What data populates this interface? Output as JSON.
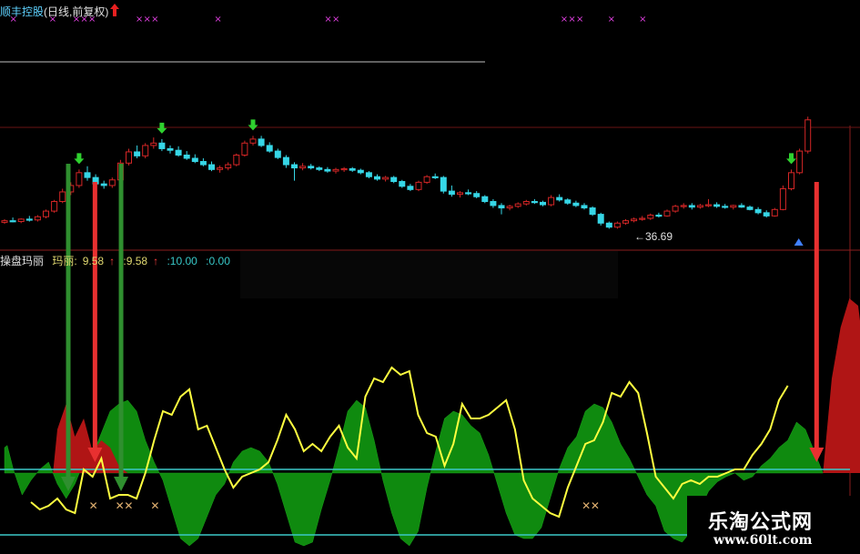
{
  "main_panel": {
    "name": "顺丰控股",
    "period": "(日线,前复权)"
  },
  "indicator_panel": {
    "name": "操盘玛丽",
    "label": "玛丽:",
    "value1": "9.58",
    "value2": ":9.58",
    "value3": ":10.00",
    "value4": ":0.00"
  },
  "annotations": {
    "low_price": "36.69"
  },
  "watermark": {
    "site_name": "乐淘公式网",
    "url": "www.60lt.com"
  },
  "colors": {
    "up": "#d42626",
    "down": "#36d6e6",
    "buy_signal": "#2fd12f",
    "sell_signal": "#e83030",
    "yellow_line": "#ffff40",
    "green_fill": "#0f8a0f",
    "red_fill": "#b01515",
    "cyan_line": "#3cc8c8"
  },
  "chart_data": [
    {
      "type": "candlestick",
      "low_label": 36.69,
      "ohlc": [
        [
          39.0,
          39.4,
          38.8,
          39.2
        ],
        [
          39.2,
          39.6,
          39.0,
          39.1
        ],
        [
          39.1,
          39.5,
          38.9,
          39.4
        ],
        [
          39.4,
          39.8,
          39.1,
          39.3
        ],
        [
          39.3,
          39.9,
          39.1,
          39.7
        ],
        [
          39.7,
          40.6,
          39.5,
          40.4
        ],
        [
          40.4,
          41.8,
          40.2,
          41.6
        ],
        [
          41.6,
          43.2,
          41.4,
          42.8
        ],
        [
          42.8,
          44.0,
          42.4,
          43.6
        ],
        [
          43.6,
          45.6,
          43.3,
          45.2
        ],
        [
          45.2,
          46.0,
          44.2,
          44.6
        ],
        [
          44.6,
          45.0,
          43.5,
          43.8
        ],
        [
          43.8,
          44.2,
          43.2,
          43.6
        ],
        [
          43.6,
          44.6,
          43.3,
          44.3
        ],
        [
          44.3,
          46.8,
          44.1,
          46.4
        ],
        [
          46.4,
          48.2,
          46.1,
          47.8
        ],
        [
          47.8,
          48.6,
          47.0,
          47.3
        ],
        [
          47.3,
          48.9,
          47.0,
          48.6
        ],
        [
          48.6,
          49.6,
          48.2,
          48.9
        ],
        [
          48.9,
          49.4,
          47.9,
          48.2
        ],
        [
          48.2,
          48.6,
          47.6,
          48.0
        ],
        [
          48.0,
          48.5,
          47.2,
          47.4
        ],
        [
          47.4,
          47.9,
          46.8,
          47.0
        ],
        [
          47.0,
          47.5,
          46.4,
          46.6
        ],
        [
          46.6,
          47.0,
          46.0,
          46.2
        ],
        [
          46.2,
          46.6,
          45.4,
          45.6
        ],
        [
          45.6,
          46.1,
          45.2,
          45.8
        ],
        [
          45.8,
          46.5,
          45.5,
          46.2
        ],
        [
          46.2,
          47.6,
          46.0,
          47.4
        ],
        [
          47.4,
          49.2,
          47.2,
          48.9
        ],
        [
          48.9,
          49.8,
          48.6,
          49.4
        ],
        [
          49.4,
          49.8,
          48.4,
          48.6
        ],
        [
          48.6,
          49.0,
          47.7,
          47.9
        ],
        [
          47.9,
          48.2,
          46.9,
          47.1
        ],
        [
          47.1,
          47.4,
          45.8,
          46.2
        ],
        [
          46.2,
          46.5,
          44.2,
          45.8
        ],
        [
          45.8,
          46.4,
          45.5,
          46.0
        ],
        [
          46.0,
          46.3,
          45.6,
          45.8
        ],
        [
          45.8,
          46.0,
          45.4,
          45.6
        ],
        [
          45.6,
          45.9,
          45.2,
          45.4
        ],
        [
          45.4,
          45.8,
          45.1,
          45.6
        ],
        [
          45.6,
          45.9,
          45.3,
          45.7
        ],
        [
          45.7,
          45.9,
          45.3,
          45.5
        ],
        [
          45.5,
          45.7,
          45.0,
          45.2
        ],
        [
          45.2,
          45.4,
          44.5,
          44.7
        ],
        [
          44.7,
          45.0,
          44.2,
          44.4
        ],
        [
          44.4,
          44.8,
          44.1,
          44.6
        ],
        [
          44.6,
          44.8,
          43.9,
          44.1
        ],
        [
          44.1,
          44.3,
          43.3,
          43.5
        ],
        [
          43.5,
          43.8,
          42.9,
          43.1
        ],
        [
          43.1,
          44.2,
          42.9,
          44.0
        ],
        [
          44.0,
          44.9,
          43.8,
          44.7
        ],
        [
          44.7,
          45.1,
          44.4,
          44.6
        ],
        [
          44.6,
          44.8,
          42.6,
          42.9
        ],
        [
          42.9,
          43.6,
          42.2,
          42.5
        ],
        [
          42.5,
          42.9,
          42.1,
          42.7
        ],
        [
          42.7,
          43.1,
          42.4,
          42.6
        ],
        [
          42.6,
          42.9,
          42.0,
          42.2
        ],
        [
          42.2,
          42.4,
          41.4,
          41.6
        ],
        [
          41.6,
          41.9,
          40.8,
          41.1
        ],
        [
          41.1,
          41.4,
          40.0,
          40.8
        ],
        [
          40.8,
          41.2,
          40.5,
          41.0
        ],
        [
          41.0,
          41.5,
          40.8,
          41.3
        ],
        [
          41.3,
          41.8,
          41.1,
          41.6
        ],
        [
          41.6,
          41.9,
          41.3,
          41.5
        ],
        [
          41.5,
          41.7,
          41.0,
          41.2
        ],
        [
          41.2,
          42.4,
          41.0,
          42.1
        ],
        [
          42.1,
          42.5,
          41.6,
          41.8
        ],
        [
          41.8,
          42.0,
          41.2,
          41.4
        ],
        [
          41.4,
          41.7,
          40.9,
          41.1
        ],
        [
          41.1,
          41.4,
          40.6,
          40.8
        ],
        [
          40.8,
          41.0,
          39.8,
          40.0
        ],
        [
          40.0,
          40.2,
          38.6,
          38.9
        ],
        [
          38.9,
          39.1,
          38.2,
          38.4
        ],
        [
          38.4,
          39.1,
          38.2,
          38.9
        ],
        [
          38.9,
          39.4,
          38.7,
          39.2
        ],
        [
          39.2,
          39.6,
          39.0,
          39.4
        ],
        [
          39.4,
          39.8,
          39.2,
          39.5
        ],
        [
          39.5,
          40.1,
          39.3,
          39.9
        ],
        [
          39.9,
          40.2,
          39.6,
          39.8
        ],
        [
          39.8,
          40.6,
          39.7,
          40.4
        ],
        [
          40.4,
          41.2,
          40.2,
          41.0
        ],
        [
          41.0,
          41.4,
          40.7,
          41.1
        ],
        [
          41.1,
          41.4,
          40.6,
          40.9
        ],
        [
          40.9,
          41.3,
          40.7,
          41.1
        ],
        [
          41.1,
          41.9,
          40.9,
          41.2
        ],
        [
          41.2,
          41.5,
          40.8,
          41.0
        ],
        [
          41.0,
          41.3,
          40.7,
          40.9
        ],
        [
          40.9,
          41.2,
          40.6,
          41.1
        ],
        [
          41.1,
          41.4,
          40.8,
          40.9
        ],
        [
          40.9,
          41.1,
          40.5,
          40.6
        ],
        [
          40.6,
          40.9,
          40.0,
          40.2
        ],
        [
          40.2,
          40.5,
          39.6,
          39.8
        ],
        [
          39.8,
          40.8,
          39.7,
          40.6
        ],
        [
          40.6,
          43.6,
          40.5,
          43.2
        ],
        [
          43.2,
          45.6,
          43.0,
          45.2
        ],
        [
          45.2,
          48.2,
          45.0,
          47.9
        ],
        [
          47.9,
          52.2,
          47.6,
          51.8
        ]
      ],
      "buy_signals": [
        9,
        19,
        30,
        95
      ],
      "sell_signals": [
        30
      ],
      "top_markers": [
        0,
        5,
        8,
        9,
        10,
        16,
        17,
        18,
        26,
        40,
        41,
        70,
        71,
        72,
        76,
        80
      ]
    },
    {
      "type": "area",
      "green_area": [
        [
          0,
          0.35
        ],
        [
          0.3,
          0.38
        ],
        [
          1,
          0.05
        ],
        [
          2,
          -0.3
        ],
        [
          3,
          -0.1
        ],
        [
          4,
          0.05
        ],
        [
          5,
          0.15
        ],
        [
          6,
          -0.15
        ],
        [
          7,
          -0.35
        ],
        [
          8,
          -0.15
        ],
        [
          9,
          0.15
        ],
        [
          10,
          0.25
        ],
        [
          11,
          0.55
        ],
        [
          12,
          0.85
        ],
        [
          13,
          0.95
        ],
        [
          14,
          1.0
        ],
        [
          15,
          0.85
        ],
        [
          16,
          0.45
        ],
        [
          17,
          0.15
        ],
        [
          18,
          -0.1
        ],
        [
          19,
          -0.5
        ],
        [
          20,
          -0.9
        ],
        [
          21,
          -1.0
        ],
        [
          22,
          -0.9
        ],
        [
          23,
          -0.6
        ],
        [
          24,
          -0.3
        ],
        [
          25,
          -0.15
        ],
        [
          26,
          0.15
        ],
        [
          27,
          0.3
        ],
        [
          28,
          0.35
        ],
        [
          29,
          0.3
        ],
        [
          30,
          0.15
        ],
        [
          31,
          -0.15
        ],
        [
          32,
          -0.55
        ],
        [
          33,
          -0.95
        ],
        [
          34,
          -1.0
        ],
        [
          35,
          -0.95
        ],
        [
          36,
          -0.5
        ],
        [
          37,
          -0.1
        ],
        [
          38,
          0.35
        ],
        [
          39,
          0.85
        ],
        [
          40,
          1.0
        ],
        [
          41,
          0.9
        ],
        [
          42,
          0.45
        ],
        [
          43,
          -0.1
        ],
        [
          44,
          -0.55
        ],
        [
          45,
          -0.9
        ],
        [
          46,
          -1.0
        ],
        [
          47,
          -0.8
        ],
        [
          48,
          -0.2
        ],
        [
          49,
          0.3
        ],
        [
          50,
          0.75
        ],
        [
          51,
          0.85
        ],
        [
          52,
          0.8
        ],
        [
          53,
          0.65
        ],
        [
          54,
          0.55
        ],
        [
          55,
          0.25
        ],
        [
          56,
          -0.15
        ],
        [
          57,
          -0.55
        ],
        [
          58,
          -0.85
        ],
        [
          59,
          -0.9
        ],
        [
          60,
          -0.9
        ],
        [
          61,
          -0.75
        ],
        [
          62,
          -0.35
        ],
        [
          63,
          0.05
        ],
        [
          64,
          0.35
        ],
        [
          65,
          0.5
        ],
        [
          66,
          0.85
        ],
        [
          67,
          0.95
        ],
        [
          68,
          0.9
        ],
        [
          69,
          0.7
        ],
        [
          70,
          0.4
        ],
        [
          71,
          0.2
        ],
        [
          72,
          -0.05
        ],
        [
          73,
          -0.3
        ],
        [
          74,
          -0.45
        ],
        [
          75,
          -0.8
        ],
        [
          76,
          -0.9
        ],
        [
          77,
          -0.95
        ],
        [
          78,
          -0.8
        ],
        [
          79,
          -0.5
        ],
        [
          80,
          -0.25
        ],
        [
          81,
          -0.12
        ],
        [
          82,
          -0.05
        ],
        [
          83,
          0.0
        ],
        [
          84,
          -0.1
        ],
        [
          85,
          -0.05
        ],
        [
          86,
          0.1
        ],
        [
          87,
          0.2
        ],
        [
          88,
          0.35
        ],
        [
          89,
          0.45
        ],
        [
          90,
          0.7
        ],
        [
          91,
          0.6
        ],
        [
          92,
          0.3
        ],
        [
          93,
          0.0
        ]
      ],
      "red_area": [
        [
          5.5,
          0
        ],
        [
          6,
          0.6
        ],
        [
          7,
          0.95
        ],
        [
          8,
          0.5
        ],
        [
          9,
          0.75
        ],
        [
          10,
          0.3
        ],
        [
          11,
          0.45
        ],
        [
          12,
          0.35
        ],
        [
          13,
          0.1
        ],
        [
          14,
          0
        ],
        [
          93,
          0
        ],
        [
          94,
          1.3
        ],
        [
          95,
          2.0
        ],
        [
          96,
          2.4
        ],
        [
          97,
          2.3
        ],
        [
          98,
          1.3
        ],
        [
          99,
          0.5
        ]
      ],
      "yellow_line": [
        [
          3,
          -0.4
        ],
        [
          4,
          -0.5
        ],
        [
          5,
          -0.45
        ],
        [
          6,
          -0.35
        ],
        [
          7,
          -0.5
        ],
        [
          8,
          -0.55
        ],
        [
          9,
          0.05
        ],
        [
          10,
          -0.05
        ],
        [
          11,
          0.2
        ],
        [
          12,
          -0.35
        ],
        [
          13,
          -0.3
        ],
        [
          14,
          -0.3
        ],
        [
          15,
          -0.35
        ],
        [
          16,
          0.0
        ],
        [
          17,
          0.45
        ],
        [
          18,
          0.85
        ],
        [
          19,
          0.8
        ],
        [
          20,
          1.05
        ],
        [
          21,
          1.15
        ],
        [
          22,
          0.6
        ],
        [
          23,
          0.65
        ],
        [
          24,
          0.35
        ],
        [
          25,
          0.05
        ],
        [
          26,
          -0.2
        ],
        [
          27,
          -0.05
        ],
        [
          28,
          0.0
        ],
        [
          29,
          0.05
        ],
        [
          30,
          0.15
        ],
        [
          31,
          0.45
        ],
        [
          32,
          0.8
        ],
        [
          33,
          0.6
        ],
        [
          34,
          0.3
        ],
        [
          35,
          0.4
        ],
        [
          36,
          0.3
        ],
        [
          37,
          0.5
        ],
        [
          38,
          0.65
        ],
        [
          39,
          0.35
        ],
        [
          40,
          0.2
        ],
        [
          41,
          1.05
        ],
        [
          42,
          1.3
        ],
        [
          43,
          1.25
        ],
        [
          44,
          1.45
        ],
        [
          45,
          1.35
        ],
        [
          46,
          1.4
        ],
        [
          47,
          0.8
        ],
        [
          48,
          0.55
        ],
        [
          49,
          0.5
        ],
        [
          50,
          0.1
        ],
        [
          51,
          0.4
        ],
        [
          52,
          0.95
        ],
        [
          53,
          0.75
        ],
        [
          54,
          0.75
        ],
        [
          55,
          0.8
        ],
        [
          56,
          0.9
        ],
        [
          57,
          1.0
        ],
        [
          58,
          0.6
        ],
        [
          59,
          -0.1
        ],
        [
          60,
          -0.35
        ],
        [
          61,
          -0.45
        ],
        [
          62,
          -0.55
        ],
        [
          63,
          -0.6
        ],
        [
          64,
          -0.2
        ],
        [
          65,
          0.1
        ],
        [
          66,
          0.4
        ],
        [
          67,
          0.45
        ],
        [
          68,
          0.7
        ],
        [
          69,
          1.1
        ],
        [
          70,
          1.05
        ],
        [
          71,
          1.25
        ],
        [
          72,
          1.1
        ],
        [
          73,
          0.55
        ],
        [
          74,
          -0.05
        ],
        [
          75,
          -0.2
        ],
        [
          76,
          -0.35
        ],
        [
          77,
          -0.15
        ],
        [
          78,
          -0.1
        ],
        [
          79,
          -0.15
        ],
        [
          80,
          -0.05
        ],
        [
          81,
          -0.05
        ],
        [
          82,
          0.0
        ],
        [
          83,
          0.05
        ],
        [
          84,
          0.05
        ],
        [
          85,
          0.25
        ],
        [
          86,
          0.4
        ],
        [
          87,
          0.6
        ],
        [
          88,
          1.0
        ],
        [
          89,
          1.2
        ]
      ],
      "upper_line": 0.05,
      "lower_line": -0.85,
      "sell_arrows": [
        8,
        90
      ],
      "buy_arrows": [
        6,
        12,
        98
      ],
      "x_markers": [
        7,
        10,
        11,
        14,
        63,
        64
      ]
    }
  ]
}
